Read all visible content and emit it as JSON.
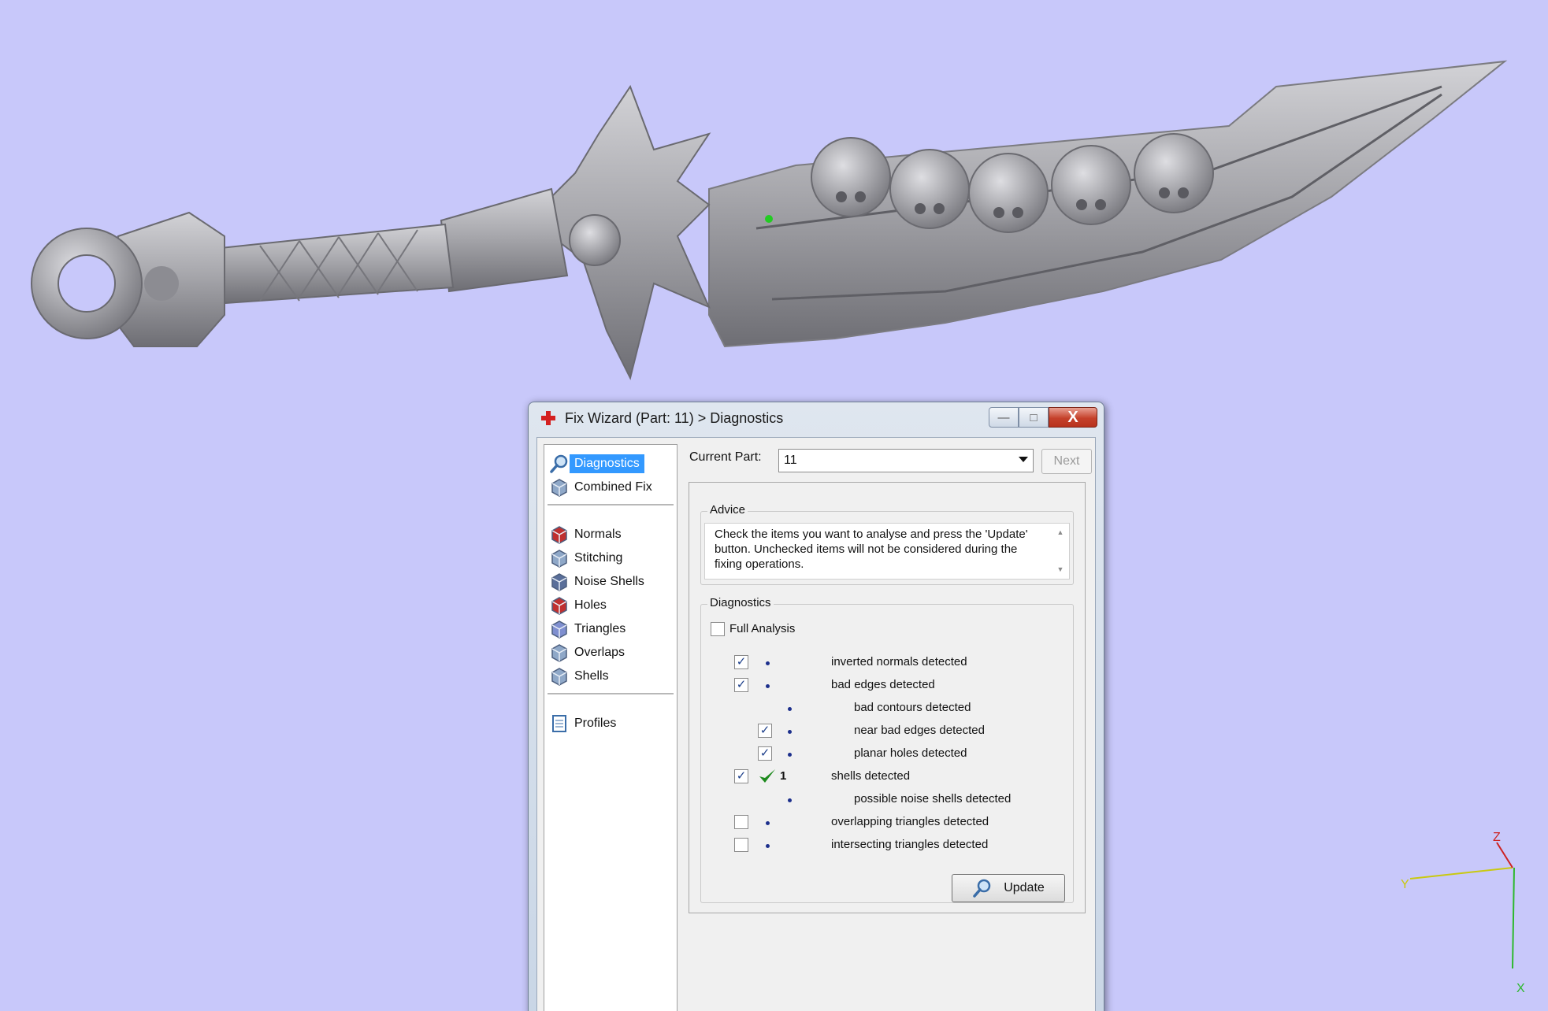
{
  "colors": {
    "viewport_bg": "#c8c8fa",
    "model": "#a9a9ad",
    "selection": "#3399ff",
    "check": "#1e8a1e"
  },
  "viewport": {
    "model_name": "",
    "axis_labels": {
      "z": "Z",
      "x": "X",
      "y": "Y"
    }
  },
  "dialog": {
    "title": "Fix Wizard (Part: 11) > Diagnostics",
    "icon": "red-cross-icon",
    "buttons": {
      "minimize": "—",
      "maximize": "□",
      "close": "X"
    },
    "nav": {
      "items": [
        {
          "label": "Diagnostics",
          "icon": "magnifier-icon",
          "selected": true
        },
        {
          "label": "Combined Fix",
          "icon": "cube-outline-icon"
        },
        {
          "label": "Normals",
          "icon": "cube-red-icon"
        },
        {
          "label": "Stitching",
          "icon": "cube-stitch-icon"
        },
        {
          "label": "Noise Shells",
          "icon": "dice-icon"
        },
        {
          "label": "Holes",
          "icon": "cube-hole-icon"
        },
        {
          "label": "Triangles",
          "icon": "cube-triangle-icon"
        },
        {
          "label": "Overlaps",
          "icon": "cube-overlap-icon"
        },
        {
          "label": "Shells",
          "icon": "cube-shell-icon"
        },
        {
          "label": "Profiles",
          "icon": "document-icon"
        }
      ]
    },
    "current_part": {
      "label": "Current Part:",
      "value": "11"
    },
    "next_label": "Next",
    "advice": {
      "title": "Advice",
      "text": "Check the items you want to analyse and press the 'Update' button. Unchecked items will not be considered during the fixing operations."
    },
    "diagnostics": {
      "title": "Diagnostics",
      "full_analysis": {
        "label": "Full Analysis",
        "checked": false
      },
      "rows": [
        {
          "label": "inverted normals detected",
          "checked": true,
          "status": "dot",
          "count": ""
        },
        {
          "label": "bad edges detected",
          "checked": true,
          "status": "dot",
          "count": ""
        },
        {
          "label": "bad contours detected",
          "checked": null,
          "status": "dot",
          "count": "",
          "indent": true
        },
        {
          "label": "near bad edges detected",
          "checked": true,
          "status": "dot",
          "count": "",
          "indent": true
        },
        {
          "label": "planar holes detected",
          "checked": true,
          "status": "dot",
          "count": "",
          "indent": true
        },
        {
          "label": "shells detected",
          "checked": true,
          "status": "ok",
          "count": "1"
        },
        {
          "label": "possible noise shells detected",
          "checked": null,
          "status": "dot",
          "count": "",
          "indent": true
        },
        {
          "label": "overlapping triangles detected",
          "checked": false,
          "status": "dot",
          "count": ""
        },
        {
          "label": "intersecting triangles detected",
          "checked": false,
          "status": "dot",
          "count": ""
        }
      ]
    },
    "update_label": "Update"
  }
}
